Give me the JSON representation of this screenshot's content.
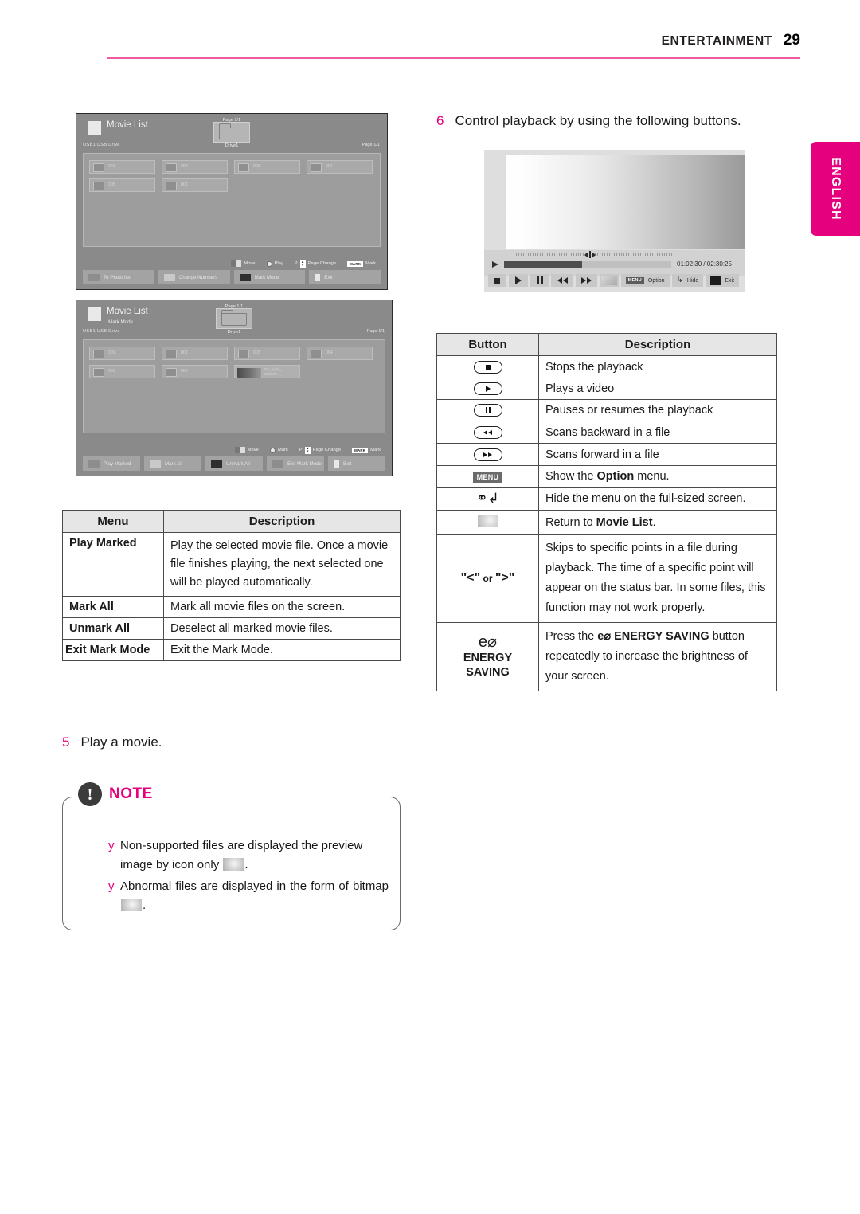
{
  "header": {
    "section": "ENTERTAINMENT",
    "page": "29"
  },
  "lang_tab": {
    "label": "ENGLISH"
  },
  "colors": {
    "accent": "#e5007d",
    "rule": "#ef5ba1"
  },
  "steps": {
    "step6": {
      "num": "6",
      "text": "Control playback by using the following buttons."
    },
    "step5": {
      "num": "5",
      "text": "Play a movie."
    }
  },
  "movie_list_screen": {
    "title": "Movie List",
    "page_top": "Page 1/1",
    "usb": "USB1   USB Drive",
    "drive_label": "Drive1",
    "page_right": "Page 1/1",
    "tiles_row1": [
      "001",
      "002",
      "003",
      "004"
    ],
    "tiles_row2": [
      "005",
      "006"
    ],
    "hints": [
      {
        "icon": "move-swatch",
        "label": "Move"
      },
      {
        "icon": "ok-circle",
        "label": "Play"
      },
      {
        "icon": "page-updown",
        "prefix": "P",
        "label": "Page Change"
      },
      {
        "icon": "mark-chip",
        "chip": "MARK",
        "label": "Mark"
      }
    ],
    "buttons": [
      {
        "label": "To Photo list",
        "chip": "mid"
      },
      {
        "label": "Change Numbers",
        "chip": "light"
      },
      {
        "label": "Mark Mode",
        "chip": "dark"
      },
      {
        "label": "Exit",
        "chip": "vlight"
      }
    ]
  },
  "mark_mode_screen": {
    "title": "Movie List",
    "sub_mode": "Mark Mode",
    "page_top": "Page 1/1",
    "usb": "USB1   USB Drive",
    "drive_label": "Drive1",
    "page_right": "Page  1/1",
    "tiles_row1": [
      "001",
      "002",
      "003",
      "004"
    ],
    "tiles_row2": [
      "005",
      "006"
    ],
    "marked_item": {
      "name": "001_Apple_...",
      "time": "02:30:25"
    },
    "hints": [
      {
        "icon": "move-swatch",
        "label": "Move"
      },
      {
        "icon": "ok-circle",
        "label": "Mark"
      },
      {
        "icon": "page-updown",
        "prefix": "P",
        "label": "Page Change"
      },
      {
        "icon": "mark-chip",
        "chip": "MARK",
        "label": "Mark"
      }
    ],
    "buttons": [
      {
        "label": "Play Marked",
        "chip": "mid"
      },
      {
        "label": "Mark All",
        "chip": "light"
      },
      {
        "label": "Unmark All",
        "chip": "dark"
      },
      {
        "label": "Exit Mark Mode",
        "chip": "mid"
      },
      {
        "label": "Exit",
        "chip": "vlight"
      }
    ]
  },
  "playback_screen": {
    "time_current": "01:02:30",
    "time_separator": " / ",
    "time_total": "02:30:25",
    "time_display": "01:02:30 / 02:30:25",
    "controls": [
      {
        "name": "stop",
        "label": ""
      },
      {
        "name": "play",
        "label": ""
      },
      {
        "name": "pause",
        "label": ""
      },
      {
        "name": "rewind",
        "label": ""
      },
      {
        "name": "fast-forward",
        "label": ""
      },
      {
        "name": "thumbnail",
        "label": ""
      },
      {
        "name": "menu-option",
        "label": "Option",
        "chip": "MENU"
      },
      {
        "name": "hide",
        "label": "Hide"
      },
      {
        "name": "exit",
        "label": "Exit"
      }
    ]
  },
  "menu_table": {
    "headers": [
      "Menu",
      "Description"
    ],
    "rows": [
      {
        "menu": "Play Marked",
        "description": "Play the selected movie file. Once a movie file finishes playing, the next selected one will be played automatically."
      },
      {
        "menu": "Mark All",
        "description": "Mark all movie files on the screen."
      },
      {
        "menu": "Unmark All",
        "description": "Deselect all marked movie files."
      },
      {
        "menu": "Exit Mark Mode",
        "description": "Exit the Mark Mode."
      }
    ]
  },
  "button_table": {
    "headers": [
      "Button",
      "Description"
    ],
    "rows": [
      {
        "icon": "stop-button-icon",
        "glyph": "stop",
        "description": "Stops the playback"
      },
      {
        "icon": "play-button-icon",
        "glyph": "play",
        "description": "Plays a video"
      },
      {
        "icon": "pause-button-icon",
        "glyph": "pause",
        "description": "Pauses or resumes the playback"
      },
      {
        "icon": "rewind-button-icon",
        "glyph": "rewind",
        "description": "Scans backward in a file"
      },
      {
        "icon": "forward-button-icon",
        "glyph": "forward",
        "description": "Scans forward in a file"
      },
      {
        "icon": "menu-button-icon",
        "glyph": "menu",
        "chip": "MENU",
        "description_prefix": "Show the ",
        "description_bold": "Option",
        "description_suffix": " menu."
      },
      {
        "icon": "back-hide-icon",
        "glyph": "back",
        "description": "Hide the menu on the full-sized screen."
      },
      {
        "icon": "return-thumbnail-icon",
        "glyph": "swatch",
        "description_prefix": "Return to ",
        "description_bold": "Movie List",
        "description_suffix": "."
      },
      {
        "icon": "skip-arrows-icon",
        "glyph": "arrows",
        "label": "\"<\" or \">\"",
        "description": "Skips to specific points in a file during playback. The time of a specific point will appear on the status bar. In some files, this function may not work properly."
      },
      {
        "icon": "energy-saving-icon",
        "glyph": "energy",
        "leaf": "e⌀",
        "line1": "ENERGY",
        "line2": "SAVING",
        "description_prefix": "Press the ",
        "description_bold": "e⌀ ENERGY SAVING",
        "description_suffix": " button repeatedly to increase the brightness of your screen."
      }
    ],
    "skip_label_left": "\"<\"",
    "skip_label_mid": " or ",
    "skip_label_right": "\">\""
  },
  "note": {
    "badge": "NOTE",
    "bullet": "y",
    "items": [
      {
        "text_before": "Non-supported files are displayed the preview image by icon only ",
        "icon": "preview-swatch-icon",
        "text_after": "."
      },
      {
        "text_before": "Abnormal files are displayed in the form of bitmap ",
        "icon": "bitmap-swatch-icon",
        "text_after": "."
      }
    ]
  }
}
